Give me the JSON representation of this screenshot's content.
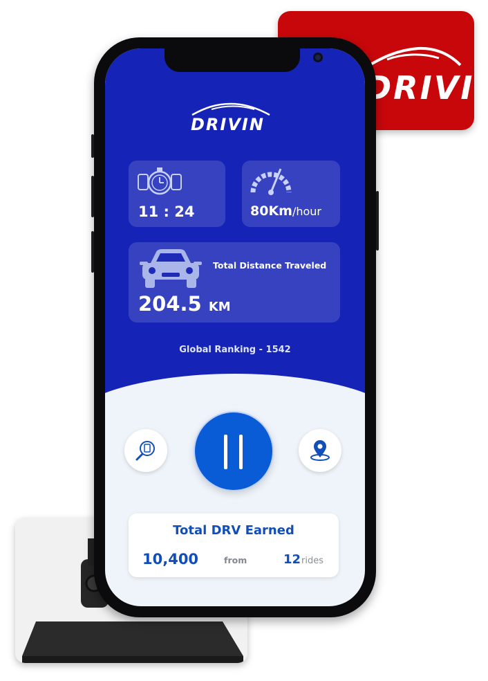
{
  "brand": {
    "name": "DRIVIN",
    "brand_red": "#c8070b",
    "app_blue": "#1523b6",
    "accent_blue": "#0a5bd6"
  },
  "stats": {
    "time": "11 : 24",
    "speed_value": "80Km",
    "speed_unit": "/hour",
    "distance_label": "Total Distance Traveled",
    "distance_value": "204.5",
    "distance_unit": "KM"
  },
  "ranking": "Global Ranking - 1542",
  "controls": {
    "left_icon": "search-document-icon",
    "center_icon": "pause-icon",
    "right_icon": "location-pin-icon"
  },
  "earnings": {
    "title": "Total DRV Earned",
    "amount": "10,400",
    "from_label": "from",
    "rides_count": "12",
    "rides_label": "rides"
  }
}
